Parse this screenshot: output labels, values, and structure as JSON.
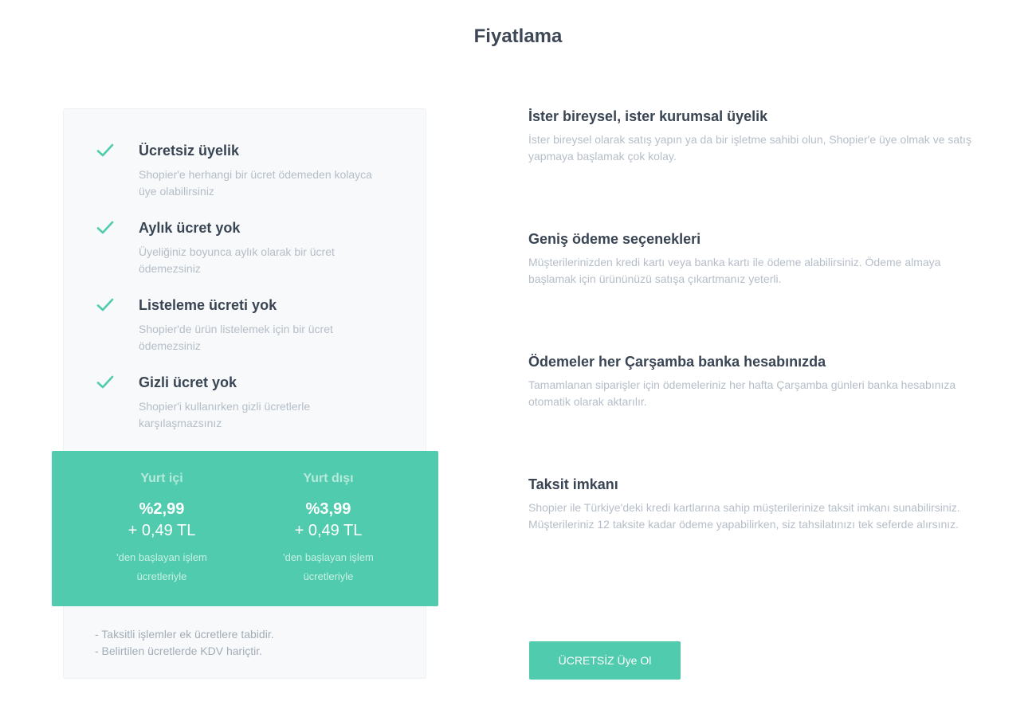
{
  "page": {
    "title": "Fiyatlama"
  },
  "features": [
    {
      "title": "Ücretsiz üyelik",
      "desc": "Shopier'e herhangi bir ücret ödemeden kolayca üye olabilirsiniz"
    },
    {
      "title": "Aylık ücret yok",
      "desc": "Üyeliğiniz boyunca aylık olarak bir ücret ödemezsiniz"
    },
    {
      "title": "Listeleme ücreti yok",
      "desc": "Shopier'de ürün listelemek için bir ücret ödemezsiniz"
    },
    {
      "title": "Gizli ücret yok",
      "desc": "Shopier'i kullanırken gizli ücretlerle karşılaşmazsınız"
    }
  ],
  "pricing": {
    "domestic": {
      "label": "Yurt içi",
      "percent": "%2,99",
      "fee": "+ 0,49 TL",
      "note_line1": "'den başlayan işlem",
      "note_line2": "ücretleriyle"
    },
    "international": {
      "label": "Yurt dışı",
      "percent": "%3,99",
      "fee": "+ 0,49 TL",
      "note_line1": "'den başlayan işlem",
      "note_line2": "ücretleriyle"
    }
  },
  "notes": [
    "- Taksitli işlemler ek ücretlere tabidir.",
    "- Belirtilen ücretlerde KDV hariçtir."
  ],
  "benefits": [
    {
      "title": "İster bireysel, ister kurumsal üyelik",
      "desc": "İster bireysel olarak satış yapın ya da bir işletme sahibi olun, Shopier'e üye olmak ve satış yapmaya başlamak çok kolay."
    },
    {
      "title": "Geniş ödeme seçenekleri",
      "desc": "Müşterilerinizden kredi kartı veya banka kartı ile ödeme alabilirsiniz. Ödeme almaya başlamak için ürününüzü satışa çıkartmanız yeterli."
    },
    {
      "title": "Ödemeler her Çarşamba banka hesabınızda",
      "desc": "Tamamlanan siparişler için ödemeleriniz her hafta Çarşamba günleri banka hesabınıza otomatik olarak aktarılır."
    },
    {
      "title": "Taksit imkanı",
      "desc": "Shopier ile Türkiye'deki kredi kartlarına sahip müşterilerinize taksit imkanı sunabilirsiniz. Müşterileriniz 12 taksite kadar ödeme yapabilirken, siz tahsilatınızı tek seferde alırsınız."
    }
  ],
  "cta": {
    "label": "ÜCRETSİZ Üye Ol"
  },
  "colors": {
    "accent": "#50cbad",
    "check": "#50cbad",
    "heading": "#3a4554",
    "muted": "#b5bec8"
  },
  "icons": {
    "feature_check": "check-icon"
  }
}
